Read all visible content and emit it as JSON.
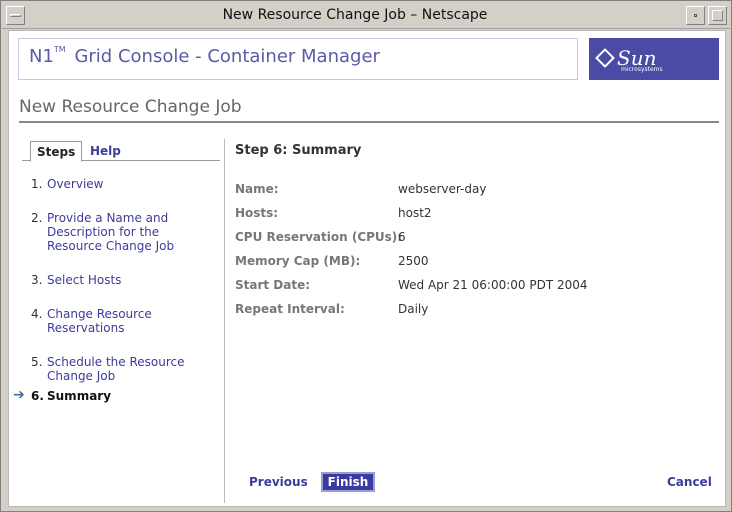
{
  "window": {
    "title": "New Resource Change Job – Netscape"
  },
  "masthead": {
    "app_name_prefix": "N1",
    "trademark": "TM",
    "app_name": "Grid Console - Container Manager",
    "logo_text": "Sun",
    "logo_sub": "microsystems"
  },
  "page": {
    "title": "New Resource Change Job"
  },
  "tabs": [
    {
      "label": "Steps",
      "active": true
    },
    {
      "label": "Help",
      "active": false
    }
  ],
  "steps": [
    {
      "num": "1.",
      "label": "Overview",
      "lines": [
        "Overview"
      ]
    },
    {
      "num": "2.",
      "label": "Provide a Name and Description for the Resource Change Job",
      "lines": [
        "Provide a Name and",
        "Description for the",
        "Resource Change Job"
      ]
    },
    {
      "num": "3.",
      "label": "Select Hosts",
      "lines": [
        "Select Hosts"
      ]
    },
    {
      "num": "4.",
      "label": "Change Resource Reservations",
      "lines": [
        "Change Resource",
        "Reservations"
      ]
    },
    {
      "num": "5.",
      "label": "Schedule the Resource Change Job",
      "lines": [
        "Schedule the Resource",
        "Change Job"
      ]
    },
    {
      "num": "6.",
      "label": "Summary",
      "lines": [
        "Summary"
      ],
      "current": true
    }
  ],
  "summary": {
    "heading": "Step 6: Summary",
    "rows": [
      {
        "label": "Name:",
        "value": "webserver-day"
      },
      {
        "label": "Hosts:",
        "value": "host2"
      },
      {
        "label": "CPU Reservation (CPUs):",
        "value": "6"
      },
      {
        "label": "Memory Cap (MB):",
        "value": "2500"
      },
      {
        "label": "Start Date:",
        "value": "Wed Apr 21 06:00:00 PDT 2004"
      },
      {
        "label": "Repeat Interval:",
        "value": "Daily"
      }
    ]
  },
  "buttons": {
    "previous": "Previous",
    "finish": "Finish",
    "cancel": "Cancel"
  },
  "icons": {
    "current_step": "arrow-right-icon",
    "window_menu": "window-menu-icon",
    "minimize": "minimize-icon",
    "maximize": "maximize-icon",
    "logo": "sun-logo-icon"
  },
  "colors": {
    "brand": "#4b4ba6",
    "link": "#3c3c9a",
    "window_chrome": "#d4d0c8"
  }
}
